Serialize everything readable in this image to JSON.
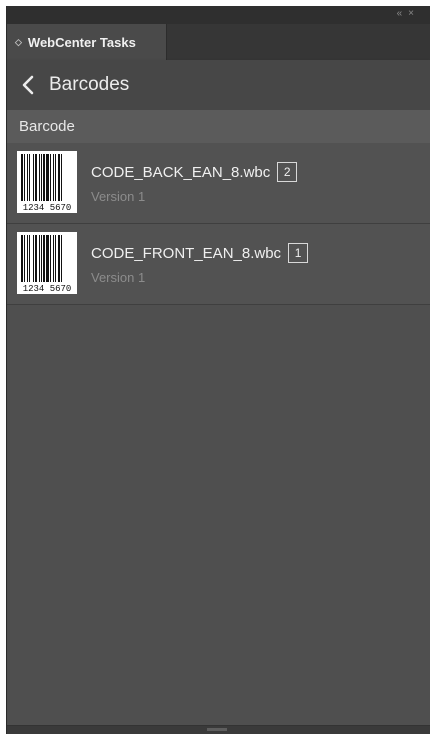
{
  "panel": {
    "collapse_icon": "double-chevron-left",
    "close_icon": "close-x",
    "tab_label": "WebCenter Tasks"
  },
  "header": {
    "title": "Barcodes",
    "back_icon": "chevron-left"
  },
  "section": {
    "label": "Barcode"
  },
  "barcodes": [
    {
      "filename": "CODE_BACK_EAN_8.wbc",
      "count": "2",
      "version": "Version 1",
      "digits": "1234 5670"
    },
    {
      "filename": "CODE_FRONT_EAN_8.wbc",
      "count": "1",
      "version": "Version 1",
      "digits": "1234 5670"
    }
  ],
  "colors": {
    "panel_bg": "#4f4f4f",
    "header_bg": "#474747",
    "section_bg": "#5b5b5b"
  }
}
